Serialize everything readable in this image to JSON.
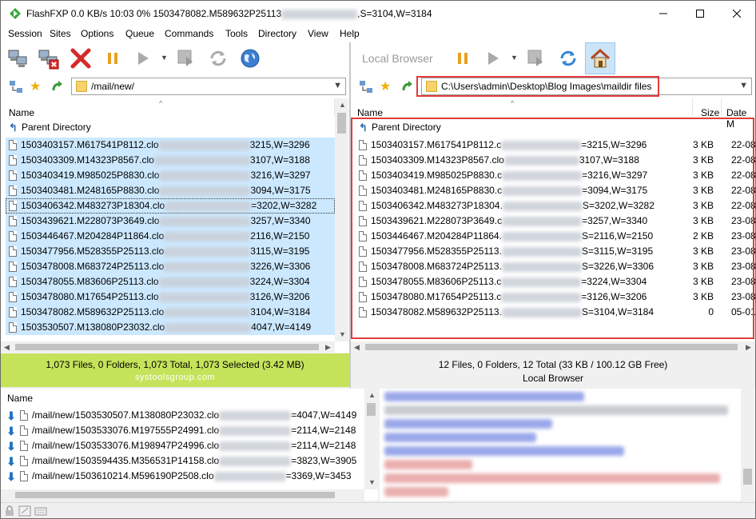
{
  "window": {
    "title_prefix": "FlashFXP 0.0 KB/s 10:03 0% 1503478082.M589632P25113",
    "title_suffix": ",S=3104,W=3184"
  },
  "menu": [
    "Session",
    "Sites",
    "Options",
    "Queue",
    "Commands",
    "Tools",
    "Directory",
    "View",
    "Help"
  ],
  "left": {
    "path": "/mail/new/",
    "col_name": "Name",
    "parent": "Parent Directory",
    "files": [
      {
        "pre": "1503403157.M617541P8112.clo",
        "post": "3215,W=3296"
      },
      {
        "pre": "1503403309.M14323P8567.clo",
        "post": "3107,W=3188"
      },
      {
        "pre": "1503403419.M985025P8830.clo",
        "post": "3216,W=3297"
      },
      {
        "pre": "1503403481.M248165P8830.clo",
        "post": "3094,W=3175"
      },
      {
        "pre": "1503406342.M483273P18304.clo",
        "post": "=3202,W=3282"
      },
      {
        "pre": "1503439621.M228073P3649.clo",
        "post": "3257,W=3340"
      },
      {
        "pre": "1503446467.M204284P11864.clo",
        "post": "2116,W=2150"
      },
      {
        "pre": "1503477956.M528355P25113.clo",
        "post": "3115,W=3195"
      },
      {
        "pre": "1503478008.M683724P25113.clo",
        "post": "3226,W=3306"
      },
      {
        "pre": "1503478055.M83606P25113.clo",
        "post": "3224,W=3304"
      },
      {
        "pre": "1503478080.M17654P25113.clo",
        "post": "3126,W=3206"
      },
      {
        "pre": "1503478082.M589632P25113.clo",
        "post": "3104,W=3184"
      },
      {
        "pre": "1503530507.M138080P23032.clo",
        "post": "4047,W=4149"
      }
    ],
    "status": "1,073 Files, 0 Folders, 1,073 Total, 1,073 Selected (3.42 MB)",
    "watermark": "systoolsgroup.com"
  },
  "right": {
    "label": "Local Browser",
    "path": "C:\\Users\\admin\\Desktop\\Blog Images\\maildir files",
    "col_name": "Name",
    "col_size": "Size",
    "col_date": "Date M",
    "parent": "Parent Directory",
    "files": [
      {
        "pre": "1503403157.M617541P8112.c",
        "post": "=3215,W=3296",
        "size": "3 KB",
        "date": "22-08-"
      },
      {
        "pre": "1503403309.M14323P8567.clo",
        "post": "3107,W=3188",
        "size": "3 KB",
        "date": "22-08-"
      },
      {
        "pre": "1503403419.M985025P8830.c",
        "post": "=3216,W=3297",
        "size": "3 KB",
        "date": "22-08-"
      },
      {
        "pre": "1503403481.M248165P8830.c",
        "post": "=3094,W=3175",
        "size": "3 KB",
        "date": "22-08-"
      },
      {
        "pre": "1503406342.M483273P18304.",
        "post": "S=3202,W=3282",
        "size": "3 KB",
        "date": "22-08-"
      },
      {
        "pre": "1503439621.M228073P3649.c",
        "post": "=3257,W=3340",
        "size": "3 KB",
        "date": "23-08-"
      },
      {
        "pre": "1503446467.M204284P11864.",
        "post": "S=2116,W=2150",
        "size": "2 KB",
        "date": "23-08-"
      },
      {
        "pre": "1503477956.M528355P25113.",
        "post": "S=3115,W=3195",
        "size": "3 KB",
        "date": "23-08-"
      },
      {
        "pre": "1503478008.M683724P25113.",
        "post": "S=3226,W=3306",
        "size": "3 KB",
        "date": "23-08-"
      },
      {
        "pre": "1503478055.M83606P25113.c",
        "post": "=3224,W=3304",
        "size": "3 KB",
        "date": "23-08-"
      },
      {
        "pre": "1503478080.M17654P25113.c",
        "post": "=3126,W=3206",
        "size": "3 KB",
        "date": "23-08-"
      },
      {
        "pre": "1503478082.M589632P25113.",
        "post": "S=3104,W=3184",
        "size": "0",
        "date": "05-01-"
      }
    ],
    "status": "12 Files, 0 Folders, 12 Total (33 KB / 100.12 GB Free)",
    "status2": "Local Browser"
  },
  "queue": {
    "col_name": "Name",
    "items": [
      {
        "pre": "/mail/new/1503530507.M138080P23032.clo",
        "post": "=4047,W=4149"
      },
      {
        "pre": "/mail/new/1503533076.M197555P24991.clo",
        "post": "=2114,W=2148"
      },
      {
        "pre": "/mail/new/1503533076.M198947P24996.clo",
        "post": "=2114,W=2148"
      },
      {
        "pre": "/mail/new/1503594435.M356531P14158.clo",
        "post": "=3823,W=3905"
      },
      {
        "pre": "/mail/new/1503610214.M596190P2508.clo",
        "post": "=3369,W=3453"
      }
    ]
  },
  "colors": {
    "accent_selection": "#cce8ff",
    "status_green": "#c5e35a",
    "highlight_red": "#e03c3c"
  }
}
